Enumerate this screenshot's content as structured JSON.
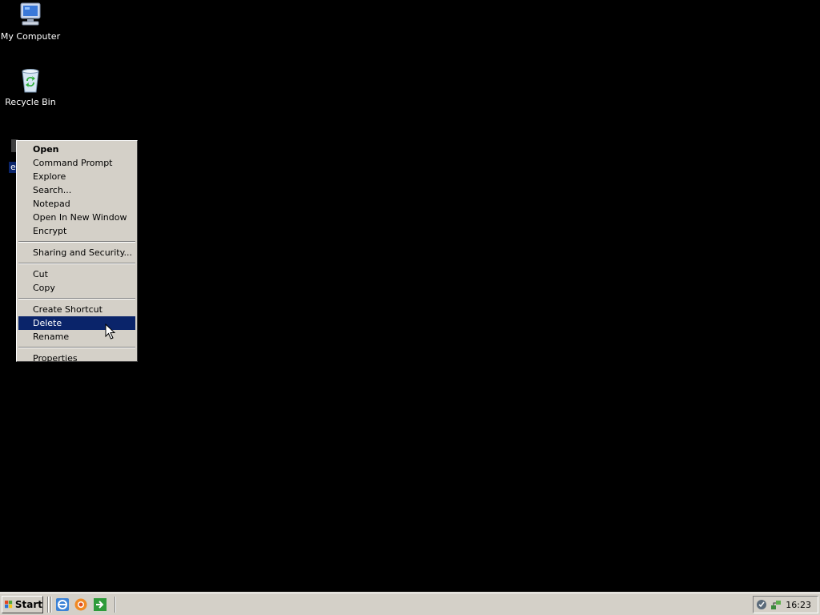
{
  "desktop": {
    "icons": [
      {
        "label": "My Computer"
      },
      {
        "label": "Recycle Bin"
      },
      {
        "label": "e"
      }
    ]
  },
  "context_menu": {
    "items": [
      "Open",
      "Command Prompt",
      "Explore",
      "Search...",
      "Notepad",
      "Open In New Window",
      "Encrypt",
      "Sharing and Security...",
      "Cut",
      "Copy",
      "Create Shortcut",
      "Delete",
      "Rename",
      "Properties"
    ],
    "highlighted": "Delete"
  },
  "taskbar": {
    "start_label": "Start",
    "clock": "16:23"
  },
  "colors": {
    "desktop_bg": "#000000",
    "highlight": "#0a246a",
    "menu_bg": "#d4d0c8"
  }
}
